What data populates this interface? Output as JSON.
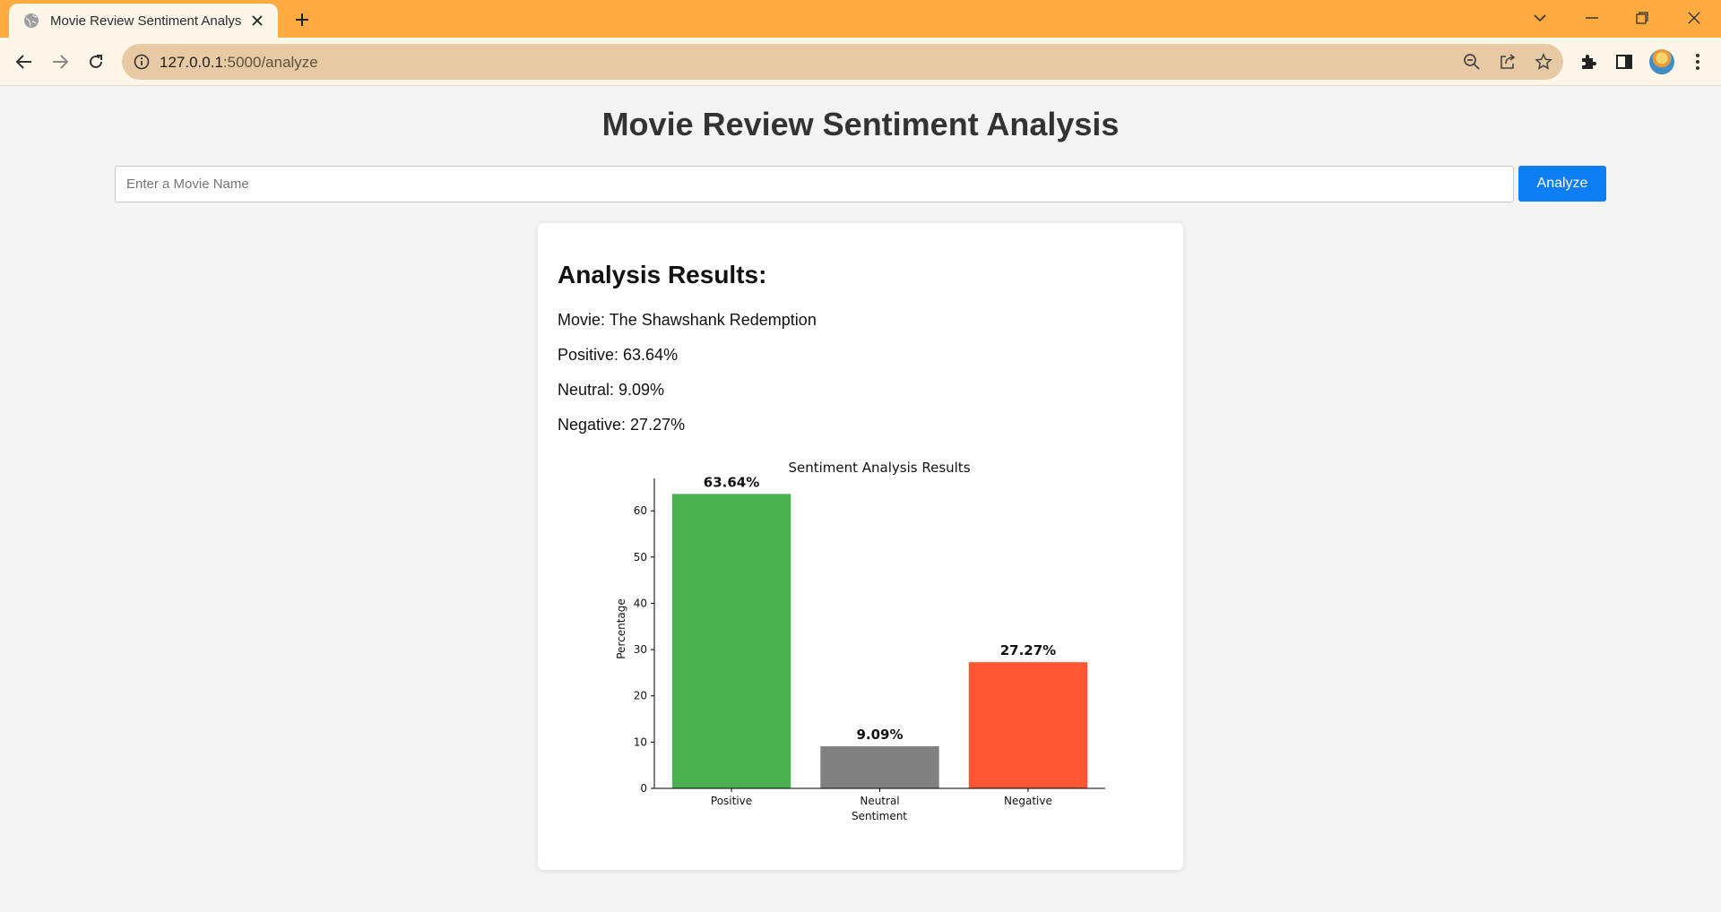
{
  "browser": {
    "tab_title": "Movie Review Sentiment Analysis",
    "url_host": "127.0.0.1",
    "url_path": ":5000/analyze"
  },
  "page": {
    "title": "Movie Review Sentiment Analysis",
    "search": {
      "placeholder": "Enter a Movie Name",
      "value": ""
    },
    "analyze_label": "Analyze"
  },
  "results": {
    "heading": "Analysis Results:",
    "movie": "Movie: The Shawshank Redemption",
    "positive": "Positive: 63.64%",
    "neutral": "Neutral: 9.09%",
    "negative": "Negative: 27.27%"
  },
  "chart_data": {
    "type": "bar",
    "title": "Sentiment Analysis Results",
    "xlabel": "Sentiment",
    "ylabel": "Percentage",
    "categories": [
      "Positive",
      "Neutral",
      "Negative"
    ],
    "values": [
      63.64,
      9.09,
      27.27
    ],
    "data_labels": [
      "63.64%",
      "9.09%",
      "27.27%"
    ],
    "colors": [
      "#4caf50",
      "#808080",
      "#ff5733"
    ],
    "yticks": [
      0,
      10,
      20,
      30,
      40,
      50,
      60
    ],
    "ylim": [
      0,
      67
    ],
    "grid": false
  }
}
